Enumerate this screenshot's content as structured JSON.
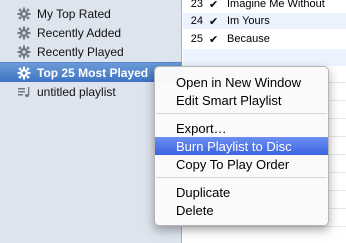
{
  "sidebar": {
    "items": [
      {
        "label": "My Top Rated",
        "icon": "gear-icon"
      },
      {
        "label": "Recently Added",
        "icon": "gear-icon"
      },
      {
        "label": "Recently Played",
        "icon": "gear-icon"
      },
      {
        "label": "Top 25 Most Played",
        "icon": "gear-icon",
        "selected": true
      },
      {
        "label": "untitled playlist",
        "icon": "playlist-icon"
      }
    ]
  },
  "tracks": [
    {
      "num": "23",
      "checked": "✔",
      "name": "Imagine Me Without"
    },
    {
      "num": "24",
      "checked": "✔",
      "name": "Im Yours"
    },
    {
      "num": "25",
      "checked": "✔",
      "name": "Because"
    }
  ],
  "context_menu": {
    "items": [
      {
        "label": "Open in New Window"
      },
      {
        "label": "Edit Smart Playlist"
      },
      {
        "label": "Export…"
      },
      {
        "label": "Burn Playlist to Disc",
        "highlighted": true
      },
      {
        "label": "Copy To Play Order"
      },
      {
        "label": "Duplicate"
      },
      {
        "label": "Delete"
      }
    ]
  },
  "colors": {
    "sidebar_bg": "#dde4ed",
    "selection": "#3f74c2",
    "menu_highlight": "#3b63e0"
  }
}
